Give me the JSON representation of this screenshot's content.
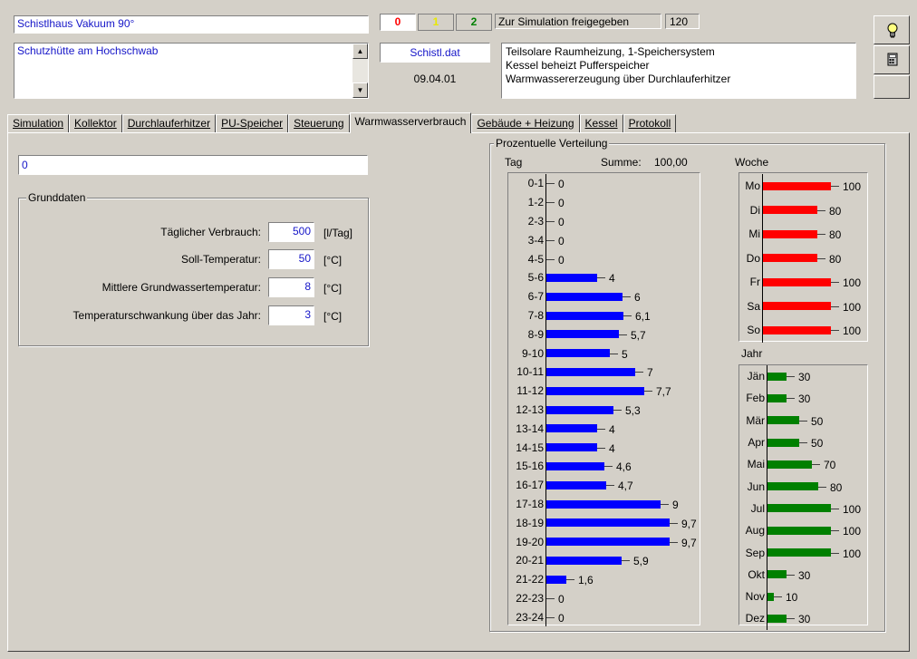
{
  "header": {
    "project_name": "Schistlhaus Vakuum 90°",
    "description": "Schutzhütte am Hochschwab",
    "status_red": "0",
    "status_yellow": "1",
    "status_green": "2",
    "status_text": "Zur Simulation freigegeben",
    "status_number": "120",
    "file_name": "Schistl.dat",
    "date": "09.04.01",
    "system_line1": "Teilsolare Raumheizung, 1-Speichersystem",
    "system_line2": "Kessel beheizt Pufferspeicher",
    "system_line3": "Warmwassererzeugung über Durchlauferhitzer",
    "colors": {
      "red": "#ff0000",
      "yellow": "#ffff00",
      "green": "#008000",
      "blue": "#0000ff"
    },
    "icons": [
      "lightbulb-icon",
      "calculator-icon"
    ]
  },
  "tabs": [
    {
      "label": "Simulation",
      "active": false
    },
    {
      "label": "Kollektor",
      "active": false
    },
    {
      "label": "Durchlauferhitzer",
      "active": false
    },
    {
      "label": "PU-Speicher",
      "active": false
    },
    {
      "label": "Steuerung",
      "active": false
    },
    {
      "label": "Warmwasserverbrauch",
      "active": true
    },
    {
      "label": "Gebäude + Heizung",
      "active": false
    },
    {
      "label": "Kessel",
      "active": false
    },
    {
      "label": "Protokoll",
      "active": false
    }
  ],
  "main": {
    "name_field": "0",
    "grunddaten": {
      "title": "Grunddaten",
      "rows": [
        {
          "label": "Täglicher Verbrauch:",
          "value": "500",
          "unit": "[l/Tag]"
        },
        {
          "label": "Soll-Temperatur:",
          "value": "50",
          "unit": "[°C]"
        },
        {
          "label": "Mittlere Grundwassertemperatur:",
          "value": "8",
          "unit": "[°C]"
        },
        {
          "label": "Temperaturschwankung über das Jahr:",
          "value": "3",
          "unit": "[°C]"
        }
      ]
    }
  },
  "distribution": {
    "title": "Prozentuelle Verteilung",
    "tag_title": "Tag",
    "summe_label": "Summe:",
    "summe_value": "100,00",
    "woche_title": "Woche",
    "jahr_title": "Jahr"
  },
  "chart_data": [
    {
      "type": "bar",
      "title": "Tag",
      "categories": [
        "0-1",
        "1-2",
        "2-3",
        "3-4",
        "4-5",
        "5-6",
        "6-7",
        "7-8",
        "8-9",
        "9-10",
        "10-11",
        "11-12",
        "12-13",
        "13-14",
        "14-15",
        "15-16",
        "16-17",
        "17-18",
        "18-19",
        "19-20",
        "20-21",
        "21-22",
        "22-23",
        "23-24"
      ],
      "values": [
        0,
        0,
        0,
        0,
        0,
        4,
        6,
        6.1,
        5.7,
        5,
        7,
        7.7,
        5.3,
        4,
        4,
        4.6,
        4.7,
        9,
        9.7,
        9.7,
        5.9,
        1.6,
        0,
        0
      ],
      "labels": [
        "0",
        "0",
        "0",
        "0",
        "0",
        "4",
        "6",
        "6,1",
        "5,7",
        "5",
        "7",
        "7,7",
        "5,3",
        "4",
        "4",
        "4,6",
        "4,7",
        "9",
        "9,7",
        "9,7",
        "5,9",
        "1,6",
        "0",
        "0"
      ],
      "color": "#0000ff",
      "max": 10
    },
    {
      "type": "bar",
      "title": "Woche",
      "categories": [
        "Mo",
        "Di",
        "Mi",
        "Do",
        "Fr",
        "Sa",
        "So"
      ],
      "values": [
        100,
        80,
        80,
        80,
        100,
        100,
        100
      ],
      "labels": [
        "100",
        "80",
        "80",
        "80",
        "100",
        "100",
        "100"
      ],
      "color": "#ff0000",
      "max": 100
    },
    {
      "type": "bar",
      "title": "Jahr",
      "categories": [
        "Jän",
        "Feb",
        "Mär",
        "Apr",
        "Mai",
        "Jun",
        "Jul",
        "Aug",
        "Sep",
        "Okt",
        "Nov",
        "Dez"
      ],
      "values": [
        30,
        30,
        50,
        50,
        70,
        80,
        100,
        100,
        100,
        30,
        10,
        30
      ],
      "labels": [
        "30",
        "30",
        "50",
        "50",
        "70",
        "80",
        "100",
        "100",
        "100",
        "30",
        "10",
        "30"
      ],
      "color": "#008000",
      "max": 100
    }
  ]
}
